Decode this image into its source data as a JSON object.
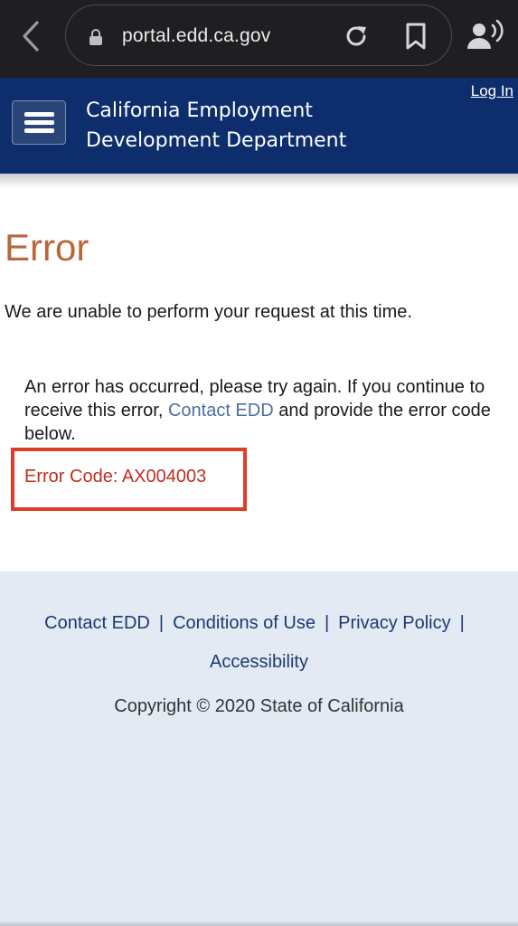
{
  "browser": {
    "url": "portal.edd.ca.gov"
  },
  "header": {
    "title_line1": "California Employment",
    "title_line2": "Development Department",
    "login_label": "Log In"
  },
  "main": {
    "title": "Error",
    "intro": "We are unable to perform your request at this time.",
    "detail_part1": "An error has occurred, please try again. If you continue to receive this error, ",
    "detail_link": "Contact EDD",
    "detail_part2": " and provide the error code below.",
    "error_code": "Error Code: AX004003"
  },
  "footer": {
    "links": [
      "Contact EDD",
      "Conditions of Use",
      "Privacy Policy",
      "Accessibility"
    ],
    "separator": "|",
    "copyright": "Copyright © 2020 State of California"
  },
  "colors": {
    "header_bg": "#0d2d6c",
    "error_title": "#b8663a",
    "error_code": "#c22c20",
    "highlight": "#e03c2a",
    "footer_bg": "#e3eaf4"
  }
}
